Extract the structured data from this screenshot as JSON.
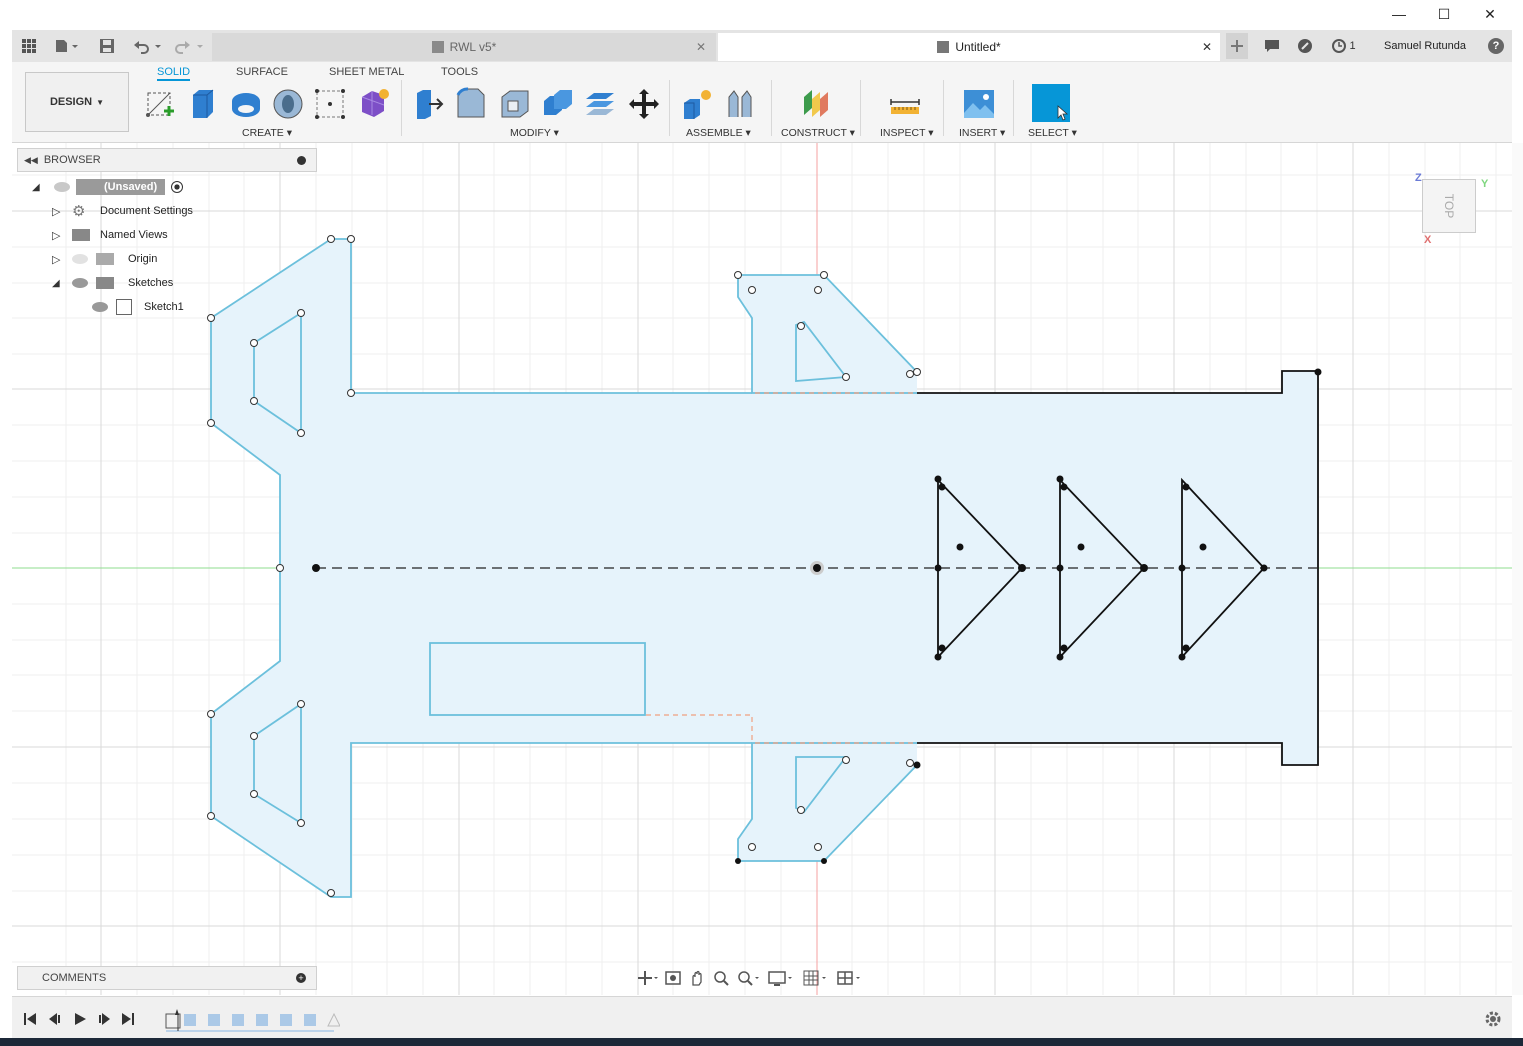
{
  "window": {
    "minimize": "—",
    "maximize": "☐",
    "close": "✕"
  },
  "tabs": [
    {
      "label": "RWL v5*",
      "active": false
    },
    {
      "label": "Untitled*",
      "active": true
    }
  ],
  "tab_close": "✕",
  "account": {
    "job_count": "1",
    "user": "Samuel Rutunda",
    "help": "?"
  },
  "workspace": {
    "label": "DESIGN"
  },
  "ribbon_tabs": [
    "SOLID",
    "SURFACE",
    "SHEET METAL",
    "TOOLS"
  ],
  "ribbon_groups": {
    "create": "CREATE",
    "modify": "MODIFY",
    "assemble": "ASSEMBLE",
    "construct": "CONSTRUCT",
    "inspect": "INSPECT",
    "insert": "INSERT",
    "select": "SELECT"
  },
  "browser": {
    "title": "BROWSER",
    "root": "(Unsaved)",
    "items": [
      {
        "label": "Document Settings"
      },
      {
        "label": "Named Views"
      },
      {
        "label": "Origin"
      },
      {
        "label": "Sketches"
      },
      {
        "label": "Sketch1"
      }
    ]
  },
  "comments": {
    "title": "COMMENTS"
  },
  "viewcube": {
    "face": "TOP",
    "axis_z": "Z",
    "axis_y": "Y",
    "axis_x": "X"
  },
  "colors": {
    "accent": "#0696d7",
    "sketch_profile": "#6cc0dc",
    "profile_fill": "#e6f3fb",
    "sketch_line": "#111111",
    "axis_red": "#f08080",
    "axis_green": "#7fd67f",
    "grid": "#e3e3e3"
  }
}
